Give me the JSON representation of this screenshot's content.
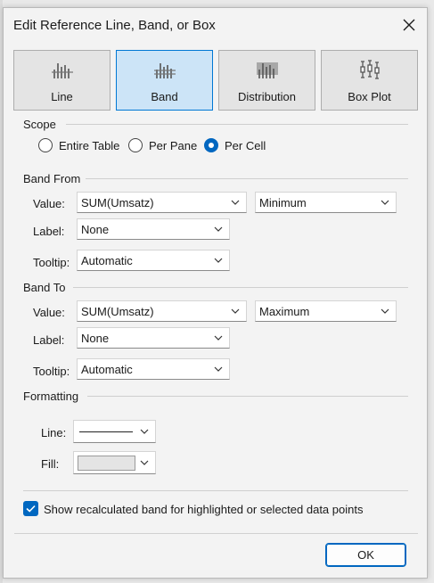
{
  "dialog": {
    "title": "Edit Reference Line, Band, or Box",
    "close_icon": "close-icon"
  },
  "types": [
    {
      "label": "Line",
      "icon": "line-chart-icon",
      "active": false
    },
    {
      "label": "Band",
      "icon": "band-chart-icon",
      "active": true
    },
    {
      "label": "Distribution",
      "icon": "distribution-chart-icon",
      "active": false
    },
    {
      "label": "Box Plot",
      "icon": "box-plot-icon",
      "active": false
    }
  ],
  "scope": {
    "title": "Scope",
    "options": [
      "Entire Table",
      "Per Pane",
      "Per Cell"
    ],
    "selected": "Per Cell"
  },
  "band_from": {
    "title": "Band From",
    "value_label": "Value:",
    "value_field": "SUM(Umsatz)",
    "aggregation": "Minimum",
    "label_label": "Label:",
    "label_value": "None",
    "tooltip_label": "Tooltip:",
    "tooltip_value": "Automatic"
  },
  "band_to": {
    "title": "Band To",
    "value_label": "Value:",
    "value_field": "SUM(Umsatz)",
    "aggregation": "Maximum",
    "label_label": "Label:",
    "label_value": "None",
    "tooltip_label": "Tooltip:",
    "tooltip_value": "Automatic"
  },
  "formatting": {
    "title": "Formatting",
    "line_label": "Line:",
    "fill_label": "Fill:",
    "fill_color": "#e4e4e4"
  },
  "highlight": {
    "label": "Show recalculated band for highlighted or selected data points",
    "checked": true
  },
  "footer": {
    "ok_label": "OK"
  },
  "colors": {
    "accent": "#0067c0",
    "active_bg": "#cce4f7"
  }
}
